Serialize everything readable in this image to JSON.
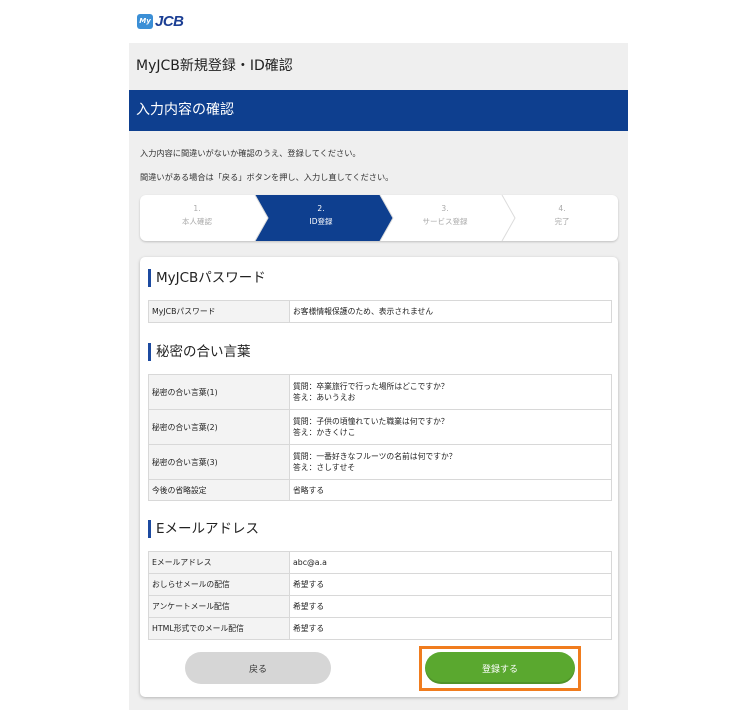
{
  "brand": {
    "badge": "My",
    "name": "JCB"
  },
  "page_title": "MyJCB新規登録・ID確認",
  "section_title": "入力内容の確認",
  "instructions": [
    "入力内容に間違いがないか確認のうえ、登録してください。",
    "間違いがある場合は「戻る」ボタンを押し、入力し直してください。"
  ],
  "steps": [
    {
      "num": "1.",
      "label": "本人確認",
      "active": false
    },
    {
      "num": "2.",
      "label": "ID登録",
      "active": true
    },
    {
      "num": "3.",
      "label": "サービス登録",
      "active": false
    },
    {
      "num": "4.",
      "label": "完了",
      "active": false
    }
  ],
  "colors": {
    "primary": "#0e3f8f",
    "register": "#5aa82f",
    "highlight": "#f07c1e",
    "background": "#efefef"
  },
  "sections": {
    "password": {
      "heading": "MyJCBパスワード",
      "rows": [
        {
          "key": "MyJCBパスワード",
          "value": "お客様情報保護のため、表示されません"
        }
      ]
    },
    "secret": {
      "heading": "秘密の合い言葉",
      "rows": [
        {
          "key": "秘密の合い言葉(1)",
          "q": "質問：卒業旅行で行った場所はどこですか？",
          "a": "答え：あいうえお"
        },
        {
          "key": "秘密の合い言葉(2)",
          "q": "質問：子供の頃憧れていた職業は何ですか？",
          "a": "答え：かきくけこ"
        },
        {
          "key": "秘密の合い言葉(3)",
          "q": "質問：一番好きなフルーツの名前は何ですか？",
          "a": "答え：さしすせそ"
        },
        {
          "key": "今後の省略設定",
          "value": "省略する"
        }
      ]
    },
    "email": {
      "heading": "Eメールアドレス",
      "rows": [
        {
          "key": "Eメールアドレス",
          "value": "abc@a.a"
        },
        {
          "key": "おしらせメールの配信",
          "value": "希望する"
        },
        {
          "key": "アンケートメール配信",
          "value": "希望する"
        },
        {
          "key": "HTML形式でのメール配信",
          "value": "希望する"
        }
      ]
    }
  },
  "buttons": {
    "back": "戻る",
    "register": "登録する"
  }
}
